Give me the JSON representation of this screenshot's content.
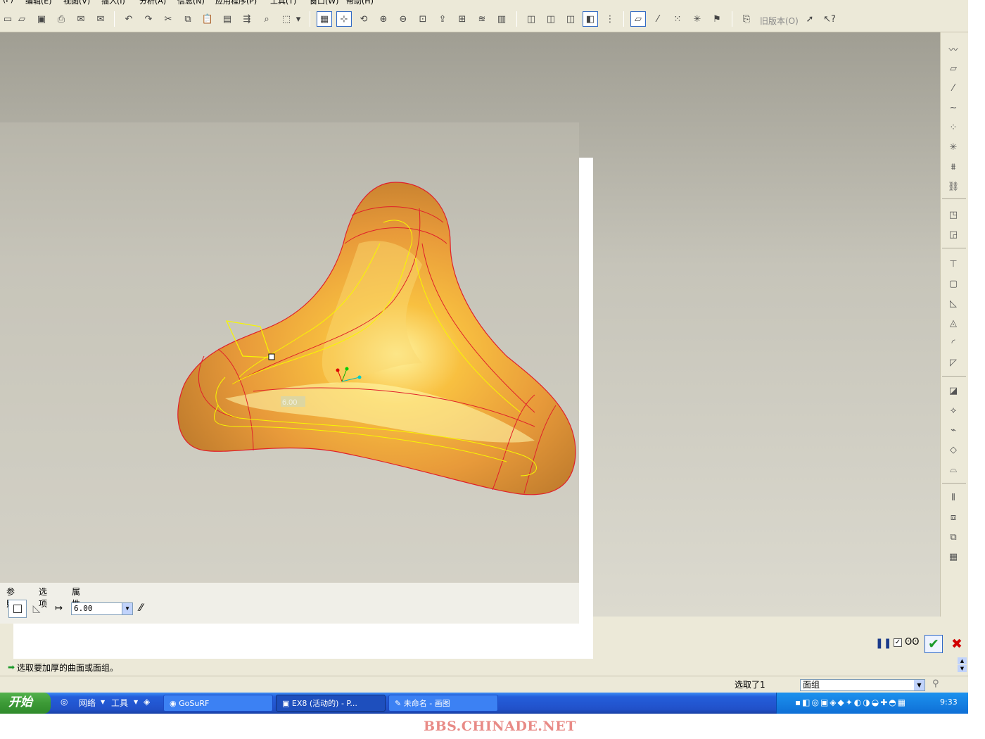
{
  "menu": {
    "items": [
      "编辑(E)",
      "视图(V)",
      "插入(I)",
      "分析(A)",
      "信息(N)",
      "应用程序(P)",
      "工具(T)",
      "窗口(W)",
      "帮助(H)"
    ]
  },
  "toolbar": {
    "legacy_label": "旧版本(O)"
  },
  "viewport": {
    "dimension_value": "6.00"
  },
  "dashboard": {
    "tabs": [
      "参照",
      "选项",
      "属性"
    ],
    "thickness_value": "6.00"
  },
  "message": {
    "prompt": "选取要加厚的曲面或面组。"
  },
  "status": {
    "selected_count": "选取了1",
    "filter_value": "面组"
  },
  "taskbar": {
    "start_label": "开始",
    "quicklaunch": [
      "网络",
      "工具"
    ],
    "tasks": [
      "GoSuRF",
      "EX8 (活动的) - P...",
      "未命名 - 画图"
    ],
    "clock": "9:33"
  },
  "watermark": "BBS.CHINADE.NET",
  "colors": {
    "surface": "#f0a030",
    "edge_red": "#e0202a",
    "curve_yellow": "#f7f700",
    "accept_green": "#1a9a2a",
    "cancel_red": "#d20000"
  }
}
